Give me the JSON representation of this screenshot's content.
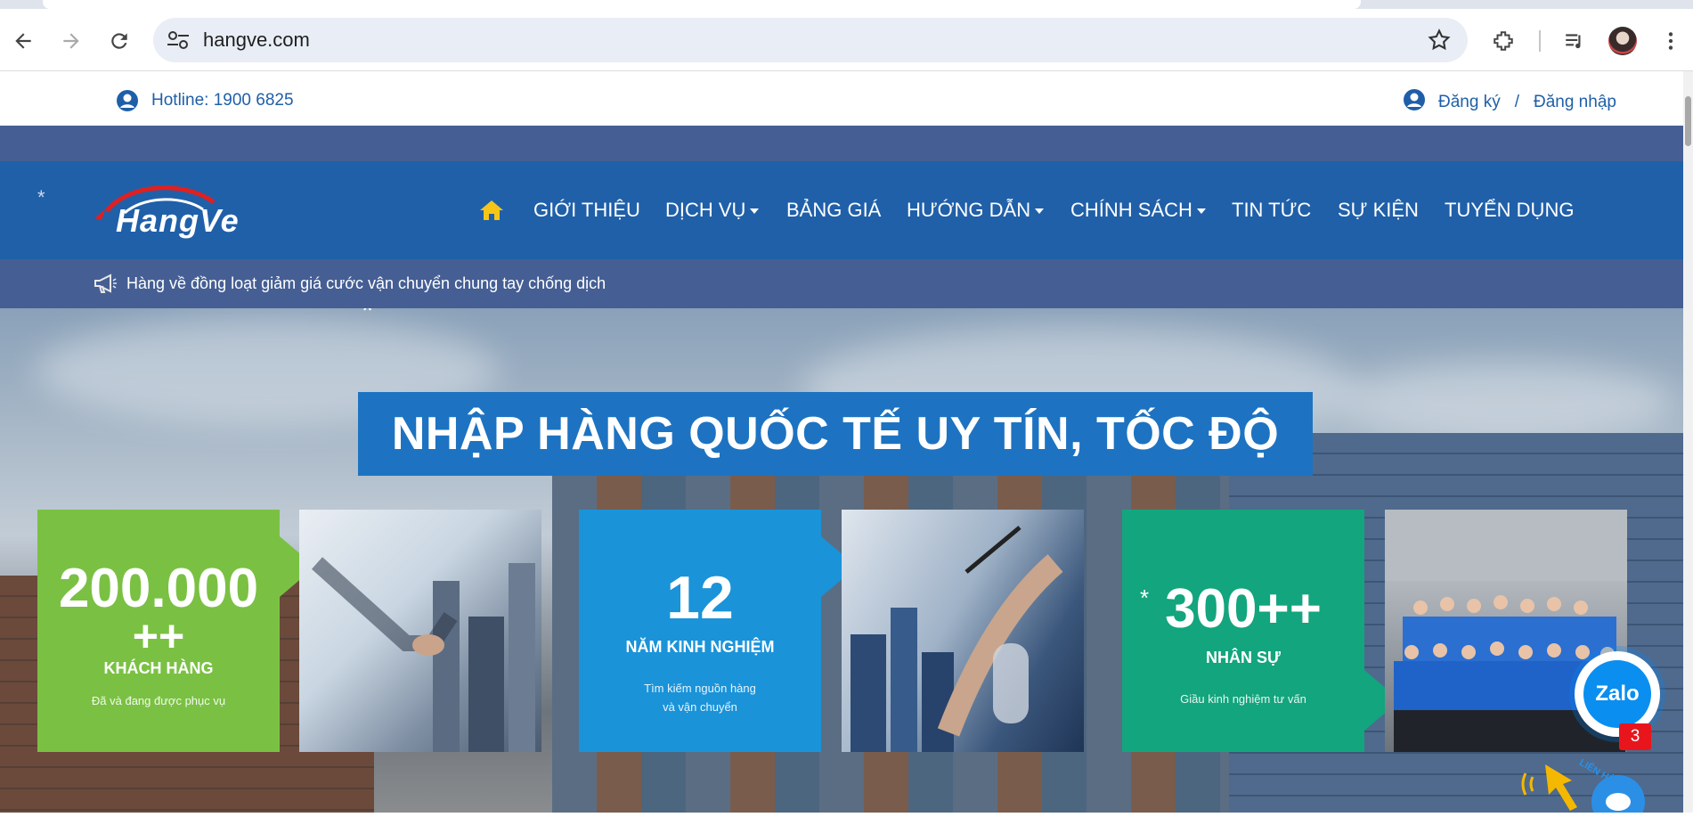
{
  "browser": {
    "url": "hangve.com",
    "icons": [
      "back-icon",
      "forward-icon",
      "reload-icon",
      "site-settings-icon",
      "bookmark-star-icon",
      "extensions-icon",
      "media-controls-icon",
      "profile-avatar",
      "more-menu-icon"
    ]
  },
  "topbar": {
    "hotline": "Hotline: 1900 6825",
    "register": "Đăng ký",
    "separator": "/",
    "login": "Đăng nhập"
  },
  "logo": {
    "text": "HangVe"
  },
  "nav": {
    "items": [
      {
        "label": "GIỚI THIỆU",
        "dropdown": false
      },
      {
        "label": "DỊCH VỤ",
        "dropdown": true
      },
      {
        "label": "BẢNG GIÁ",
        "dropdown": false
      },
      {
        "label": "HƯỚNG DẪN",
        "dropdown": true
      },
      {
        "label": "CHÍNH SÁCH",
        "dropdown": true
      },
      {
        "label": "TIN TỨC",
        "dropdown": false
      },
      {
        "label": "SỰ KIỆN",
        "dropdown": false
      },
      {
        "label": "TUYỂN DỤNG",
        "dropdown": false
      }
    ]
  },
  "announcement": "Hàng về đồng loạt giảm giá cước vận chuyển chung tay chống dịch",
  "hero": {
    "title": "NHẬP HÀNG QUỐC TẾ UY TÍN, TỐC ĐỘ",
    "stats": [
      {
        "value": "200.000",
        "value2": "++",
        "label": "KHÁCH HÀNG",
        "sub": "Đã và đang được phục vụ",
        "color": "#7ac143"
      },
      {
        "value": "12",
        "value2": "",
        "label": "NĂM KINH NGHIỆM",
        "sub": "Tìm kiếm nguồn hàng",
        "sub2": "và vận chuyển",
        "color": "#1a93d9"
      },
      {
        "value": "300++",
        "value2": "",
        "label": "NHÂN SỰ",
        "sub": "Giầu kinh nghiệm tư vấn",
        "color": "#13a57d"
      }
    ]
  },
  "chat": {
    "zalo_label": "Zalo",
    "badge": "3",
    "contact_text": "LIÊN HỆ NGAY"
  },
  "colors": {
    "nav_bg": "#2060a9",
    "band_bg": "#455f94",
    "link": "#1f5fa8",
    "home_icon": "#f5c518"
  }
}
